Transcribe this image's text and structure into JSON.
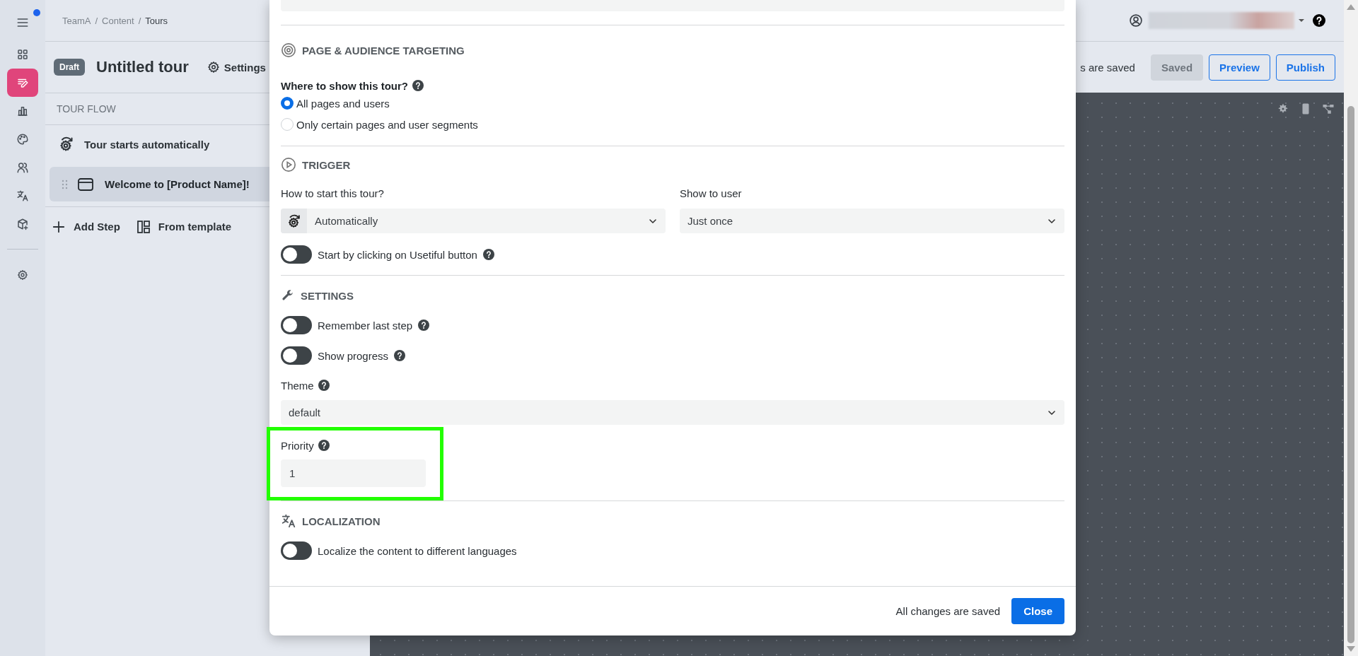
{
  "sidebar": {
    "menu_button": {
      "notification": true
    },
    "items": [
      {
        "selected": false
      },
      {
        "selected": true
      },
      {
        "selected": false
      },
      {
        "selected": false
      },
      {
        "selected": false
      },
      {
        "selected": false
      },
      {
        "selected": false
      }
    ],
    "footer_items": [
      {
        "selected": false
      }
    ]
  },
  "breadcrumb": {
    "separator": "/",
    "items": [
      {
        "label": "TeamA",
        "current": false
      },
      {
        "label": "Content",
        "current": false
      },
      {
        "label": "Tours",
        "current": true
      }
    ]
  },
  "tour": {
    "status": "Draft",
    "title": "Untitled tour",
    "settings_label": "Settings"
  },
  "save_status": "s are saved",
  "buttons": [
    {
      "label": "Saved",
      "disabled": true
    },
    {
      "label": "Preview",
      "disabled": false
    },
    {
      "label": "Publish",
      "disabled": false
    }
  ],
  "tour_flow": {
    "title": "TOUR FLOW",
    "trigger": "Tour starts automatically",
    "steps": [
      {
        "title": "Welcome to [Product Name]!",
        "selected": true
      }
    ],
    "actions": [
      {
        "kind": "add",
        "label": "Add Step"
      },
      {
        "kind": "template",
        "label": "From template"
      }
    ]
  },
  "modal": {
    "sections": [
      {
        "kind": "targeting",
        "title": "PAGE & AUDIENCE TARGETING",
        "question": "Where to show this tour?",
        "options": [
          {
            "label": "All pages and users",
            "selected": true
          },
          {
            "label": "Only certain pages and user segments",
            "selected": false
          }
        ]
      },
      {
        "kind": "trigger",
        "title": "TRIGGER",
        "fields": [
          {
            "label": "How to start this tour?",
            "value": "Automatically"
          },
          {
            "label": "Show to user",
            "value": "Just once"
          }
        ],
        "toggles": [
          {
            "label": "Start by clicking on Usetiful button",
            "on": false,
            "help": true
          }
        ]
      },
      {
        "kind": "settings",
        "title": "SETTINGS",
        "toggles": [
          {
            "label": "Remember last step",
            "on": false,
            "help": true
          },
          {
            "label": "Show progress",
            "on": false,
            "help": true
          }
        ],
        "theme": {
          "label": "Theme",
          "value": "default"
        },
        "priority": {
          "label": "Priority",
          "value": "1",
          "highlighted": true
        }
      },
      {
        "kind": "localization",
        "title": "LOCALIZATION",
        "toggles": [
          {
            "label": "Localize the content to different languages",
            "on": false,
            "help": false
          }
        ]
      }
    ],
    "footer": {
      "status": "All changes are saved",
      "close": "Close"
    }
  }
}
